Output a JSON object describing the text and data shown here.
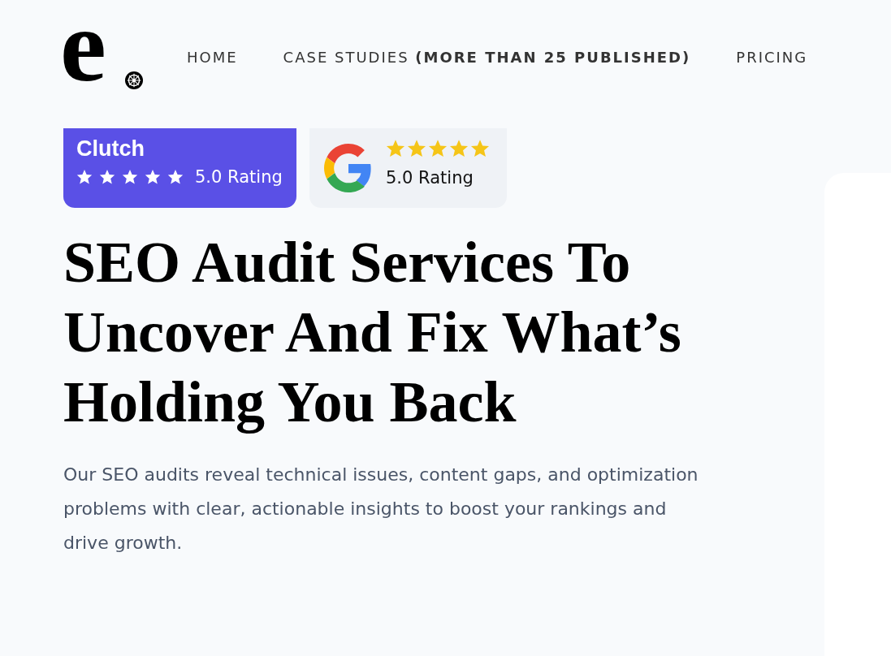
{
  "logo": {
    "letter": "e"
  },
  "nav": [
    {
      "label": "HOME"
    },
    {
      "label": "CASE STUDIES **(MORE THAN 25 PUBLISHED)**"
    },
    {
      "label": "PRICING"
    }
  ],
  "badges": [
    {
      "kind": "clutch",
      "brand": "Clutch",
      "stars": 5,
      "rating": "5.0 Rating"
    },
    {
      "kind": "google",
      "stars": 5,
      "rating": "5.0 Rating"
    }
  ],
  "heading": "SEO Audit Services To Uncover And Fix What’s Holding You Back",
  "intro": "Our SEO audits reveal technical issues, content gaps, and optimization problems with clear, actionable insights to boost your rankings and drive growth."
}
